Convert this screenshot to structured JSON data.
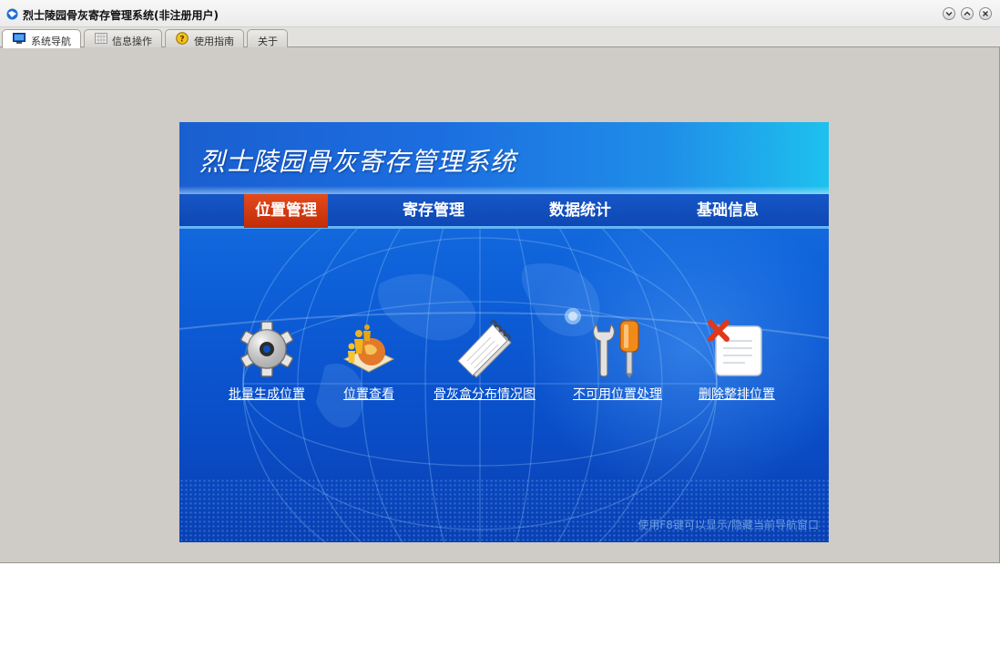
{
  "window": {
    "title": "烈士陵园骨灰寄存管理系统(非注册用户)"
  },
  "window_buttons": [
    "minimize",
    "maximize",
    "close"
  ],
  "tabs": [
    {
      "label": "系统导航",
      "icon": "monitor-icon",
      "active": true
    },
    {
      "label": "信息操作",
      "icon": "grid-icon",
      "active": false
    },
    {
      "label": "使用指南",
      "icon": "help-icon",
      "active": false
    },
    {
      "label": "关于",
      "icon": "",
      "active": false
    }
  ],
  "nav": {
    "title": "烈士陵园骨灰寄存管理系统",
    "menu": [
      {
        "label": "位置管理",
        "active": true
      },
      {
        "label": "寄存管理",
        "active": false
      },
      {
        "label": "数据统计",
        "active": false
      },
      {
        "label": "基础信息",
        "active": false
      }
    ],
    "tools": [
      {
        "label": "批量生成位置",
        "icon": "gear-icon"
      },
      {
        "label": "位置查看",
        "icon": "people-globe-icon"
      },
      {
        "label": "骨灰盒分布情况图",
        "icon": "notepad-icon"
      },
      {
        "label": "不可用位置处理",
        "icon": "tools-icon"
      },
      {
        "label": "删除整排位置",
        "icon": "delete-document-icon"
      }
    ],
    "hint": "使用F8键可以显示/隐藏当前导航窗口"
  },
  "colors": {
    "active_menu": "#d23a10",
    "panel_blue": "#0d5fd8",
    "window_bg": "#cfcbc6"
  }
}
